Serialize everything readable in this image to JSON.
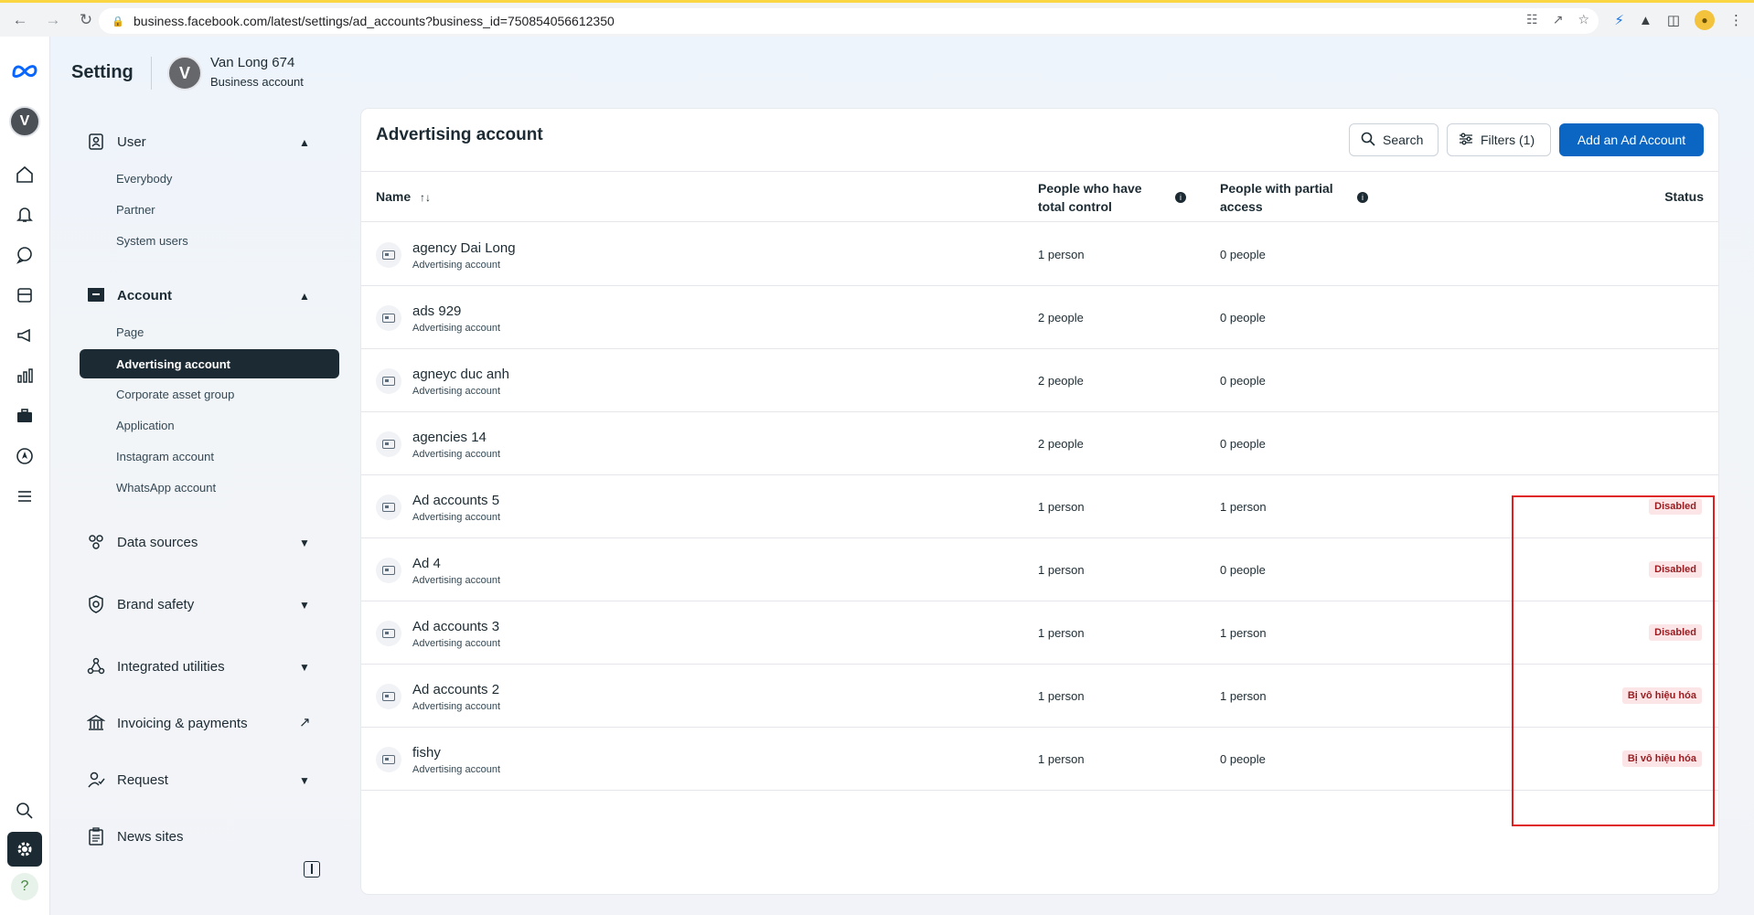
{
  "browser": {
    "url": "business.facebook.com/latest/settings/ad_accounts?business_id=750854056612350"
  },
  "header": {
    "title": "Setting",
    "avatar_letter": "V",
    "business_name": "Van Long 674",
    "business_type": "Business account"
  },
  "rail": {
    "avatar_letter": "V",
    "help_symbol": "?"
  },
  "sidebar": {
    "user": {
      "label": "User",
      "items": [
        "Everybody",
        "Partner",
        "System users"
      ]
    },
    "account": {
      "label": "Account",
      "items": [
        "Page",
        "Advertising account",
        "Corporate asset group",
        "Application",
        "Instagram account",
        "WhatsApp account"
      ],
      "active": "Advertising account"
    },
    "sections": [
      {
        "label": "Data sources",
        "icon": "data-sources-icon"
      },
      {
        "label": "Brand safety",
        "icon": "shield-icon"
      },
      {
        "label": "Integrated utilities",
        "icon": "integrations-icon"
      },
      {
        "label": "Invoicing & payments",
        "icon": "bank-icon"
      },
      {
        "label": "Request",
        "icon": "request-icon"
      },
      {
        "label": "News sites",
        "icon": "clipboard-icon"
      }
    ]
  },
  "main": {
    "title": "Advertising account",
    "search_label": "Search",
    "filters_label": "Filters (1)",
    "add_label": "Add an Ad Account",
    "columns": {
      "name": "Name",
      "sort_symbol": "↑↓",
      "total_control": "People who have total control",
      "partial_access": "People with partial access",
      "status": "Status"
    },
    "rows": [
      {
        "name": "agency Dai Long",
        "type": "Advertising account",
        "total": "1 person",
        "partial": "0 people",
        "status": ""
      },
      {
        "name": "ads 929",
        "type": "Advertising account",
        "total": "2 people",
        "partial": "0 people",
        "status": ""
      },
      {
        "name": "agneyc duc anh",
        "type": "Advertising account",
        "total": "2 people",
        "partial": "0 people",
        "status": ""
      },
      {
        "name": "agencies 14",
        "type": "Advertising account",
        "total": "2 people",
        "partial": "0 people",
        "status": ""
      },
      {
        "name": "Ad accounts 5",
        "type": "Advertising account",
        "total": "1 person",
        "partial": "1 person",
        "status": "Disabled"
      },
      {
        "name": "Ad 4",
        "type": "Advertising account",
        "total": "1 person",
        "partial": "0 people",
        "status": "Disabled"
      },
      {
        "name": "Ad accounts 3",
        "type": "Advertising account",
        "total": "1 person",
        "partial": "1 person",
        "status": "Disabled"
      },
      {
        "name": "Ad accounts 2",
        "type": "Advertising account",
        "total": "1 person",
        "partial": "1 person",
        "status": "Bị vô hiệu hóa"
      },
      {
        "name": "fishy",
        "type": "Advertising account",
        "total": "1 person",
        "partial": "0 people",
        "status": "Bị vô hiệu hóa"
      }
    ]
  },
  "colors": {
    "primary_button": "#0a66c2",
    "active_nav": "#1c2b33",
    "status_badge_bg": "#fbe5e6",
    "status_badge_text": "#9a1a1f",
    "highlight_box": "#e02020"
  }
}
